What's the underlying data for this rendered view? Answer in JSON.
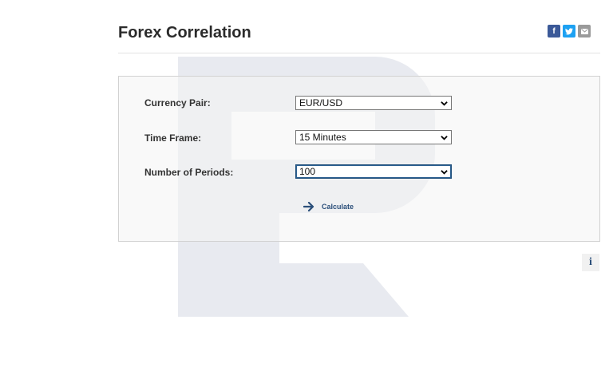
{
  "page": {
    "title": "Forex Correlation"
  },
  "social": [
    {
      "name": "facebook",
      "glyph": "f",
      "color": "#3b5998"
    },
    {
      "name": "twitter",
      "glyph": "t",
      "color": "#1da1f2"
    },
    {
      "name": "email",
      "glyph": "✉",
      "color": "#9a9a9a"
    }
  ],
  "form": {
    "currency_pair": {
      "label": "Currency Pair:",
      "value": "EUR/USD"
    },
    "time_frame": {
      "label": "Time Frame:",
      "value": "15 Minutes"
    },
    "periods": {
      "label": "Number of Periods:",
      "value": "100"
    },
    "calculate": {
      "label": "Calculate",
      "icon": "arrow-right-icon"
    }
  },
  "info": {
    "glyph": "i",
    "icon": "info-icon"
  },
  "colors": {
    "accent": "#2b4f7a",
    "watermark": "#e6e8ef"
  }
}
